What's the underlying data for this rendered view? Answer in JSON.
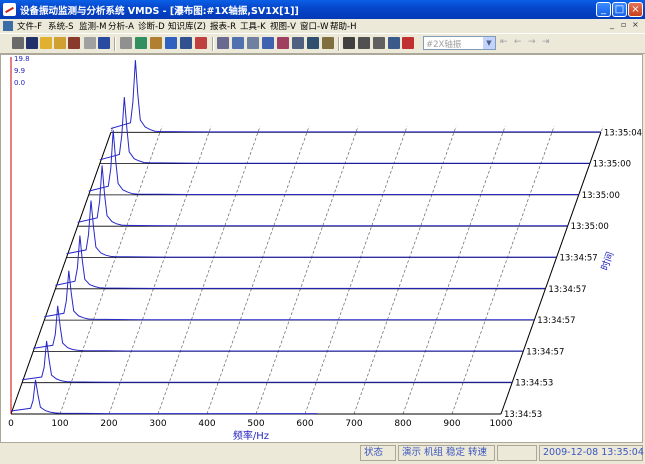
{
  "window": {
    "title": "设备振动监测与分析系统 VMDS - [瀑布图:#1X轴振,SV1X[1]]",
    "minimize": "_",
    "maximize": "□",
    "close": "×"
  },
  "menu": [
    "文件-F",
    "系统-S",
    "监测-M",
    "分析-A",
    "诊断-D",
    "知识库(Z)",
    "报表-R",
    "工具-K",
    "视图-V",
    "窗口-W",
    "帮助-H"
  ],
  "mdi": {
    "minimize": "_",
    "restore": "▫",
    "close": "×"
  },
  "toolbar": {
    "axis_select": "#2X轴振",
    "nav": [
      "⇤",
      "←",
      "→",
      "⇥"
    ]
  },
  "chart_data": {
    "type": "waterfall",
    "xlabel": "频率/Hz",
    "ylabel": "时间",
    "x_ticks": [
      0,
      100,
      200,
      300,
      400,
      500,
      600,
      700,
      800,
      900,
      1000
    ],
    "xlim": [
      0,
      1000
    ],
    "z_ticks": [
      "19.8",
      "9.9",
      "0.0"
    ],
    "zlim": [
      0,
      19.8
    ],
    "time_labels": [
      "13:34:53",
      "13:34:53",
      "13:34:57",
      "13:34:57",
      "13:34:57",
      "13:34:57",
      "13:35:00",
      "13:35:00",
      "13:35:00",
      "13:35:04"
    ],
    "series": [
      {
        "time": "13:34:53",
        "freq": [
          0,
          40,
          45,
          50,
          55,
          60,
          70,
          80,
          90,
          100,
          150,
          200,
          300,
          400,
          500,
          600,
          625
        ],
        "amp": [
          0.8,
          1.5,
          3.5,
          9,
          5,
          1.8,
          0.9,
          0.5,
          0.3,
          0.2,
          0.15,
          0.1,
          0.1,
          0.1,
          0.1,
          0.1,
          0.1
        ]
      },
      {
        "time": "13:34:53",
        "freq": [
          0,
          40,
          45,
          50,
          55,
          60,
          70,
          80,
          90,
          100,
          150,
          200,
          300,
          400,
          500,
          600,
          700,
          800,
          900,
          1000
        ],
        "amp": [
          0.8,
          1.5,
          4,
          11,
          6,
          2,
          1,
          0.5,
          0.3,
          0.2,
          0.15,
          0.1,
          0.1,
          0.1,
          0.1,
          0.1,
          0.1,
          0.1,
          0.1,
          0.1
        ]
      },
      {
        "time": "13:34:57",
        "freq": [
          0,
          40,
          45,
          50,
          55,
          60,
          70,
          80,
          90,
          100,
          150,
          200,
          300,
          400,
          500,
          600,
          700,
          800,
          900,
          1000
        ],
        "amp": [
          0.8,
          1.6,
          4.5,
          12,
          6.5,
          2.2,
          1,
          0.5,
          0.3,
          0.2,
          0.15,
          0.1,
          0.1,
          0.1,
          0.1,
          0.1,
          0.1,
          0.1,
          0.1,
          0.1
        ]
      },
      {
        "time": "13:34:57",
        "freq": [
          0,
          40,
          45,
          50,
          55,
          60,
          70,
          80,
          90,
          100,
          150,
          200,
          300,
          400,
          500,
          600,
          700,
          800,
          900,
          1000
        ],
        "amp": [
          0.9,
          1.8,
          5,
          13,
          7,
          2.4,
          1.1,
          0.6,
          0.3,
          0.2,
          0.15,
          0.1,
          0.1,
          0.1,
          0.1,
          0.1,
          0.1,
          0.1,
          0.1,
          0.1
        ]
      },
      {
        "time": "13:34:57",
        "freq": [
          0,
          40,
          45,
          50,
          55,
          60,
          70,
          80,
          90,
          100,
          150,
          200,
          300,
          400,
          500,
          600,
          700,
          800,
          900,
          1000
        ],
        "amp": [
          0.9,
          2,
          5.5,
          14,
          7.5,
          2.5,
          1.1,
          0.6,
          0.3,
          0.2,
          0.15,
          0.1,
          0.1,
          0.1,
          0.1,
          0.1,
          0.1,
          0.1,
          0.1,
          0.1
        ]
      },
      {
        "time": "13:34:57",
        "freq": [
          0,
          40,
          45,
          50,
          55,
          60,
          70,
          80,
          90,
          100,
          150,
          200,
          300,
          400,
          500,
          600,
          700,
          800,
          900,
          1000
        ],
        "amp": [
          1,
          2,
          6,
          15,
          8,
          2.7,
          1.2,
          0.6,
          0.3,
          0.2,
          0.15,
          0.1,
          0.1,
          0.1,
          0.1,
          0.1,
          0.1,
          0.1,
          0.1,
          0.1
        ]
      },
      {
        "time": "13:35:00",
        "freq": [
          0,
          40,
          45,
          50,
          55,
          60,
          70,
          80,
          90,
          100,
          150,
          200,
          300,
          400,
          500,
          600,
          700,
          800,
          900,
          1000
        ],
        "amp": [
          1,
          2.2,
          6.5,
          16,
          8.5,
          2.8,
          1.2,
          0.6,
          0.3,
          0.2,
          0.15,
          0.1,
          0.1,
          0.1,
          0.1,
          0.1,
          0.1,
          0.1,
          0.1,
          0.1
        ]
      },
      {
        "time": "13:35:00",
        "freq": [
          0,
          40,
          45,
          50,
          55,
          60,
          70,
          80,
          90,
          100,
          150,
          200,
          300,
          400,
          500,
          600,
          700,
          800,
          900,
          1000
        ],
        "amp": [
          1,
          2.3,
          7,
          17,
          9,
          3,
          1.3,
          0.7,
          0.3,
          0.2,
          0.15,
          0.1,
          0.1,
          0.1,
          0.1,
          0.1,
          0.1,
          0.1,
          0.1,
          0.1
        ]
      },
      {
        "time": "13:35:00",
        "freq": [
          0,
          40,
          45,
          50,
          55,
          60,
          70,
          80,
          90,
          100,
          150,
          200,
          300,
          400,
          500,
          600,
          700,
          800,
          900,
          1000
        ],
        "amp": [
          1,
          2.4,
          7.5,
          17.5,
          9.5,
          3.1,
          1.3,
          0.7,
          0.3,
          0.2,
          0.15,
          0.1,
          0.1,
          0.1,
          0.1,
          0.1,
          0.1,
          0.1,
          0.1,
          0.1
        ]
      },
      {
        "time": "13:35:04",
        "freq": [
          0,
          40,
          45,
          50,
          55,
          60,
          70,
          80,
          90,
          100,
          150,
          200,
          300,
          400,
          500,
          600,
          700,
          800,
          900,
          1000
        ],
        "amp": [
          1,
          2.5,
          8,
          19,
          10,
          3.2,
          1.4,
          0.7,
          0.3,
          0.2,
          0.15,
          0.1,
          0.1,
          0.1,
          0.1,
          0.1,
          0.1,
          0.1,
          0.1,
          0.1
        ]
      }
    ]
  },
  "status": {
    "state": "状态",
    "mode": "演示 机组 稳定 转速",
    "datetime": "2009-12-08 13:35:04"
  }
}
